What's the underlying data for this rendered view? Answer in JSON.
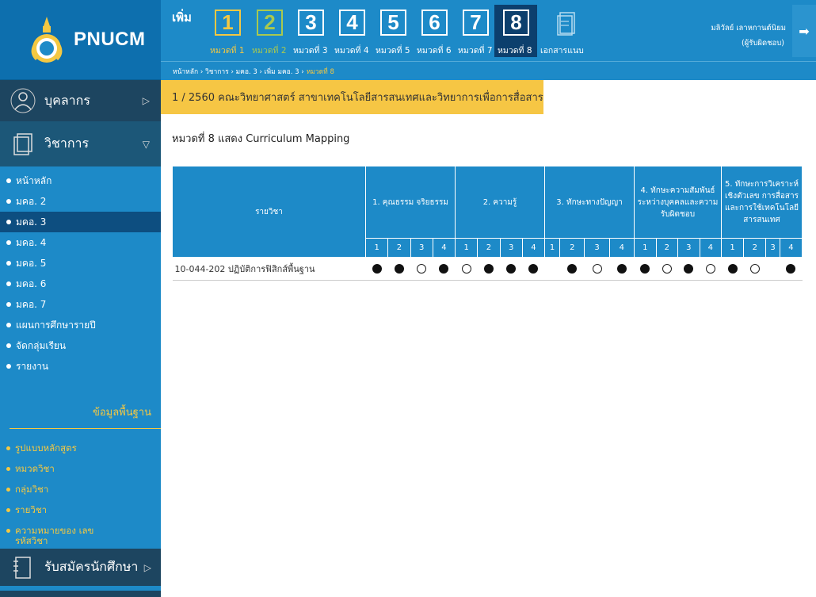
{
  "brand": {
    "name": "PNUCM"
  },
  "sidebar": {
    "sections": {
      "personnel": "บุคลากร",
      "academic": "วิชาการ",
      "admission": "รับสมัครนักศึกษา"
    },
    "academic_items": [
      {
        "label": "หน้าหลัก"
      },
      {
        "label": "มคอ. 2"
      },
      {
        "label": "มคอ. 3"
      },
      {
        "label": "มคอ. 4"
      },
      {
        "label": "มคอ. 5"
      },
      {
        "label": "มคอ. 6"
      },
      {
        "label": "มคอ. 7"
      },
      {
        "label": "แผนการศึกษารายปี"
      },
      {
        "label": "จัดกลุ่มเรียน"
      },
      {
        "label": "รายงาน"
      }
    ],
    "basic_title": "ข้อมูลพื้นฐาน",
    "basic_items": [
      {
        "label": "รูปแบบหลักสูตร"
      },
      {
        "label": "หมวดวิชา"
      },
      {
        "label": "กลุ่มวิชา"
      },
      {
        "label": "รายวิชา"
      },
      {
        "label": "ความหมายของ เลขรหัสวิชา"
      }
    ]
  },
  "topbar": {
    "add_label": "เพิ่ม",
    "chapters": [
      {
        "num": "1",
        "label": "หมวดที่ 1"
      },
      {
        "num": "2",
        "label": "หมวดที่ 2"
      },
      {
        "num": "3",
        "label": "หมวดที่ 3"
      },
      {
        "num": "4",
        "label": "หมวดที่ 4"
      },
      {
        "num": "5",
        "label": "หมวดที่ 5"
      },
      {
        "num": "6",
        "label": "หมวดที่ 6"
      },
      {
        "num": "7",
        "label": "หมวดที่ 7"
      },
      {
        "num": "8",
        "label": "หมวดที่ 8"
      }
    ],
    "attach_label": "เอกสารแนบ",
    "user_name": "มลิวัลย์ เลาหกานต์นิยม",
    "user_role": "(ผู้รับผิดชอบ)"
  },
  "breadcrumb": {
    "path": "หน้าหลัก › วิชาการ › มคอ. 3 › เพิ่ม มคอ. 3 › ",
    "current": "หมวดที่ 8"
  },
  "banner": {
    "text": "1 / 2560 คณะวิทยาศาสตร์ สาขาเทคโนโลยีสารสนเทศและวิทยาการเพื่อการสื่อสาร"
  },
  "section_title": "หมวดที่ 8 แสดง Curriculum Mapping",
  "table": {
    "course_header": "รายวิชา",
    "groups": [
      "1. คุณธรรม จริยธรรม",
      "2. ความรู้",
      "3. ทักษะทางปัญญา",
      "4. ทักษะความสัมพันธ์ระหว่างบุคคลและความรับผิดชอบ",
      "5. ทักษะการวิเคราะห์เชิงตัวเลข การสื่อสาร และการใช้เทคโนโลยีสารสนเทศ"
    ],
    "subcols": [
      "1",
      "2",
      "3",
      "4"
    ],
    "rows": [
      {
        "course": "10-044-202 ปฏิบัติการฟิสิกส์พื้นฐาน",
        "marks": [
          "full",
          "full",
          "empty",
          "full",
          "empty",
          "full",
          "full",
          "full",
          "",
          "full",
          "empty",
          "full",
          "full",
          "empty",
          "full",
          "empty",
          "full",
          "empty",
          "",
          "full"
        ]
      }
    ]
  }
}
